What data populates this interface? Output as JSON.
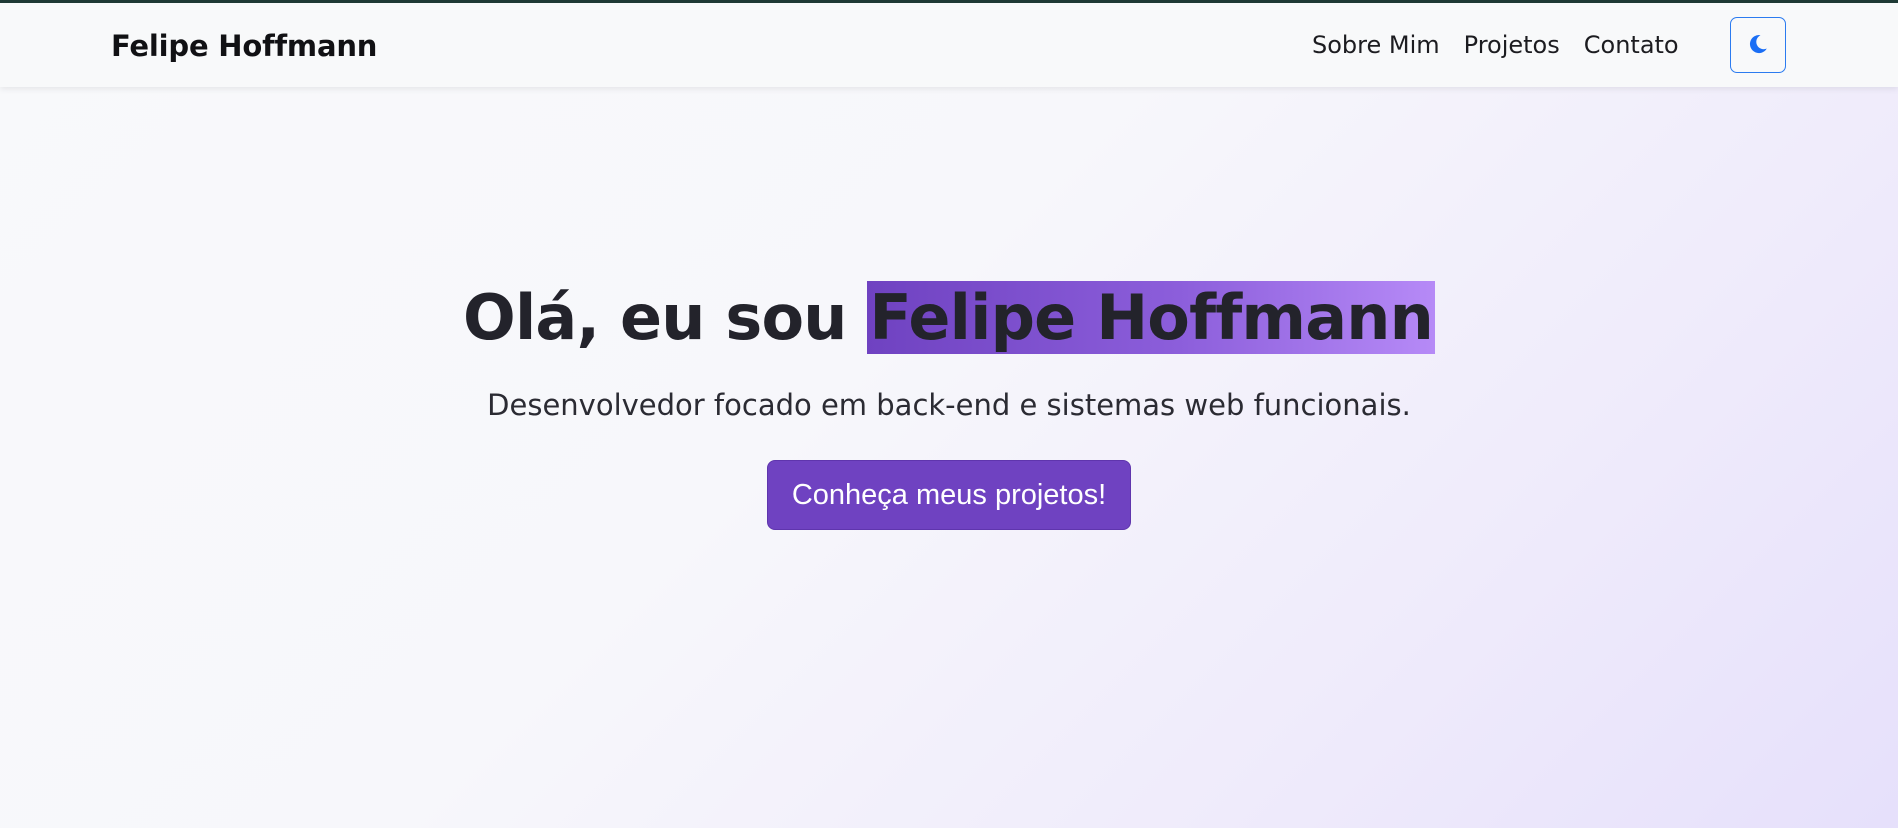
{
  "navbar": {
    "brand": "Felipe Hoffmann",
    "links": [
      {
        "label": "Sobre Mim"
      },
      {
        "label": "Projetos"
      },
      {
        "label": "Contato"
      }
    ],
    "theme_toggle_icon": "moon-icon"
  },
  "hero": {
    "title_prefix": "Olá, eu sou ",
    "title_highlight": "Felipe Hoffmann",
    "subtitle": "Desenvolvedor focado em back-end e sistemas web funcionais.",
    "cta_label": "Conheça meus projetos!"
  },
  "colors": {
    "accent": "#6f42c1",
    "toggle_border": "#2b7bf0",
    "moon_icon": "#1a6ef5"
  }
}
